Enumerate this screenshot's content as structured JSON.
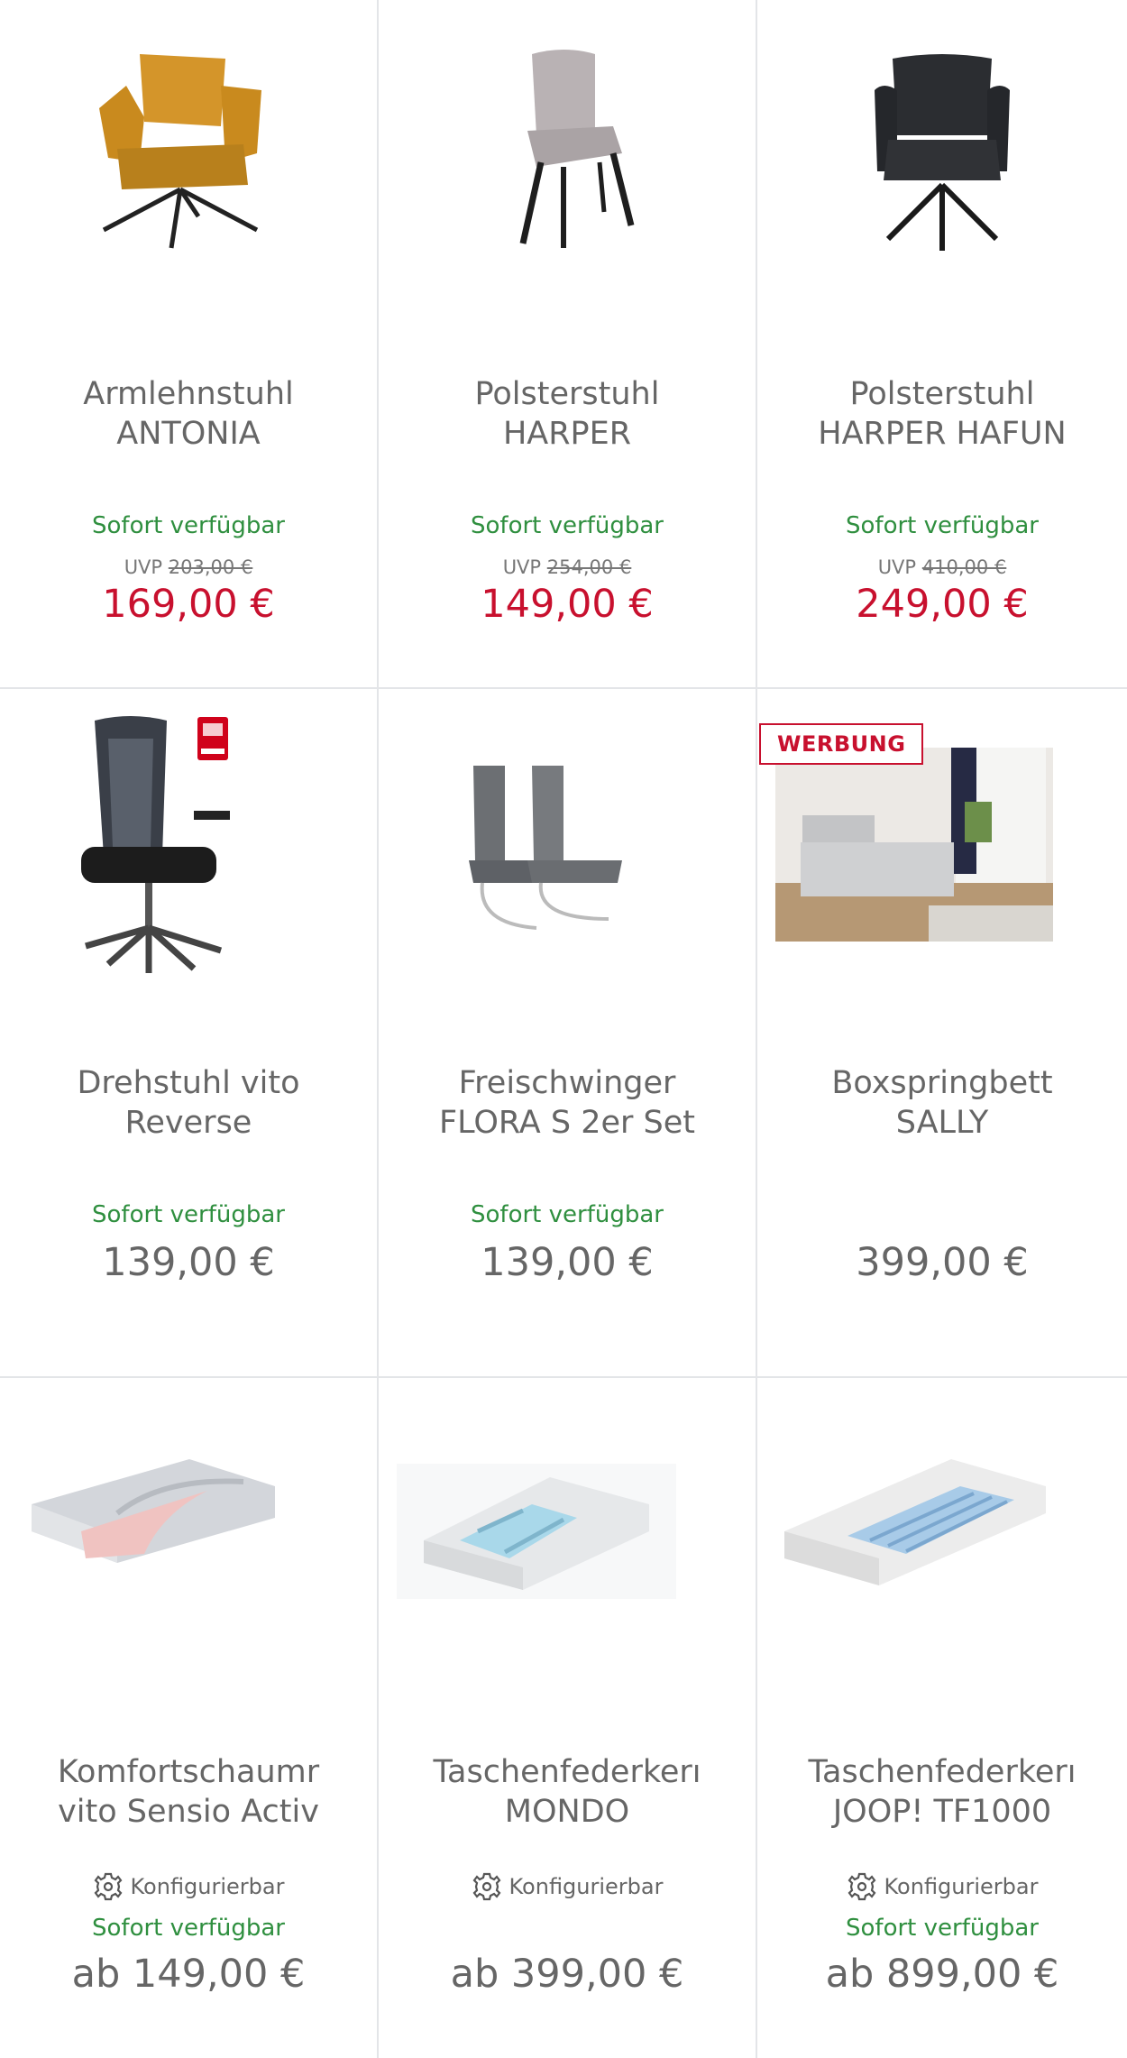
{
  "products": [
    {
      "title_line1": "Armlehnstuhl",
      "title_line2": "ANTONIA",
      "availability": "Sofort verfügbar",
      "uvp_label": "UVP",
      "uvp_price": "203,00 €",
      "price": "169,00 €",
      "image": "chair-armchair-orange-icon"
    },
    {
      "title_line1": "Polsterstuhl",
      "title_line2": "HARPER",
      "availability": "Sofort verfügbar",
      "uvp_label": "UVP",
      "uvp_price": "254,00 €",
      "price": "149,00 €",
      "image": "chair-upholstered-grey-icon"
    },
    {
      "title_line1": "Polsterstuhl",
      "title_line2": "HARPER HAFUN",
      "availability": "Sofort verfügbar",
      "uvp_label": "UVP",
      "uvp_price": "410,00 €",
      "price": "249,00 €",
      "image": "chair-armchair-black-icon"
    },
    {
      "title_line1": "Drehstuhl vito",
      "title_line2": "Reverse",
      "availability": "Sofort verfügbar",
      "price": "139,00 €",
      "image": "office-chair-icon"
    },
    {
      "title_line1": "Freischwinger",
      "title_line2": "FLORA S 2er Set",
      "availability": "Sofort verfügbar",
      "price": "139,00 €",
      "image": "cantilever-chairs-icon"
    },
    {
      "title_line1": "Boxspringbett",
      "title_line2": "SALLY",
      "badge": "WERBUNG",
      "price": "399,00 €",
      "image": "boxspring-bed-photo"
    },
    {
      "title_line1": "Komfortschaumr",
      "title_line2": "vito Sensio Activ",
      "config": "Konfigurierbar",
      "availability": "Sofort verfügbar",
      "price": "ab 149,00 €",
      "image": "foam-mattress-icon"
    },
    {
      "title_line1": "Taschenfederkerı",
      "title_line2": "MONDO",
      "config": "Konfigurierbar",
      "price": "ab 399,00 €",
      "image": "pocket-spring-mattress-icon"
    },
    {
      "title_line1": "Taschenfederkerı",
      "title_line2": "JOOP! TF1000",
      "config": "Konfigurierbar",
      "availability": "Sofort verfügbar",
      "price": "ab 899,00 €",
      "image": "joop-mattress-icon"
    }
  ],
  "colors": {
    "sale": "#c8102e",
    "availability": "#2f8f3f",
    "text": "#666666",
    "divider": "#e3e5e8"
  }
}
